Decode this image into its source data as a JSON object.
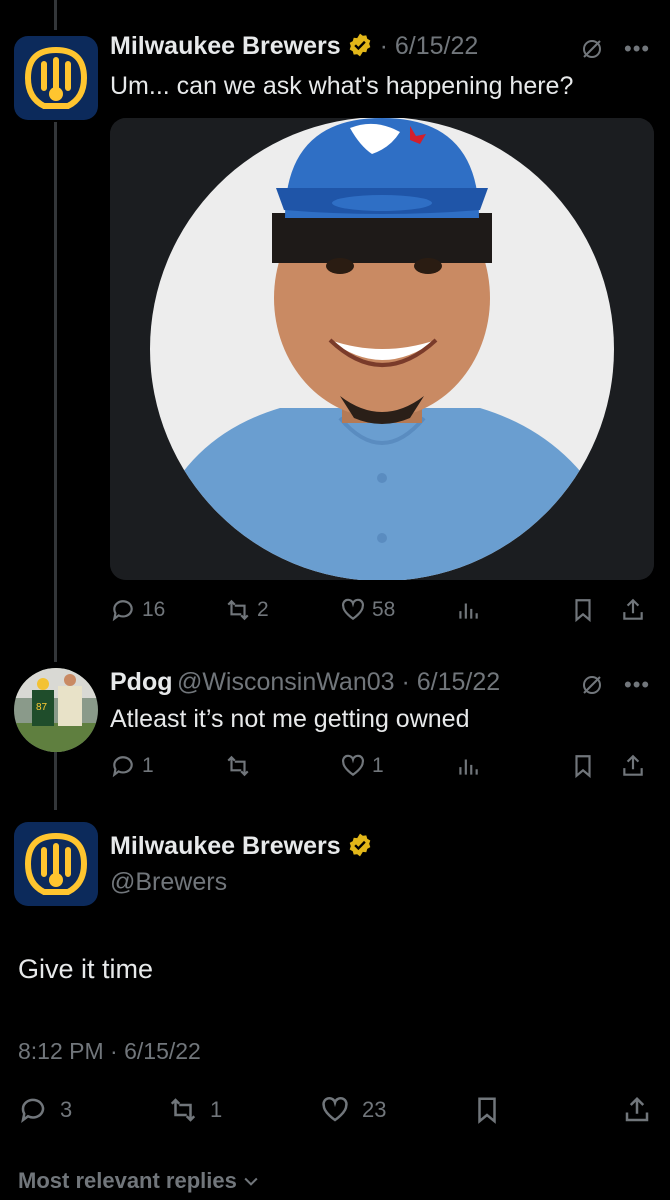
{
  "tweets": [
    {
      "author": "Milwaukee Brewers",
      "date": "6/15/22",
      "text": "Um... can we ask what's happening here?",
      "counts": {
        "replies": "16",
        "retweets": "2",
        "likes": "58"
      }
    },
    {
      "author": "Pdog",
      "handle": "@WisconsinWan03",
      "date": "6/15/22",
      "text": "Atleast it’s not me getting owned",
      "counts": {
        "replies": "1",
        "retweets": "",
        "likes": "1"
      }
    }
  ],
  "main": {
    "author": "Milwaukee Brewers",
    "handle": "@Brewers",
    "text": "Give it time",
    "timestamp": "8:12 PM · 6/15/22",
    "counts": {
      "replies": "3",
      "retweets": "1",
      "likes": "23"
    }
  },
  "footer": {
    "label": "Most relevant replies"
  },
  "colors": {
    "background": "#000000",
    "muted": "#71767b",
    "verified": "#e2b719",
    "brewers_navy": "#0c2a5b",
    "brewers_gold": "#ffc52f",
    "jays_blue": "#134a8e"
  },
  "icons": [
    "reply-icon",
    "retweet-icon",
    "like-icon",
    "views-icon",
    "bookmark-icon",
    "share-icon",
    "verified-badge-icon",
    "grok-icon",
    "more-icon",
    "chevron-down-icon"
  ]
}
